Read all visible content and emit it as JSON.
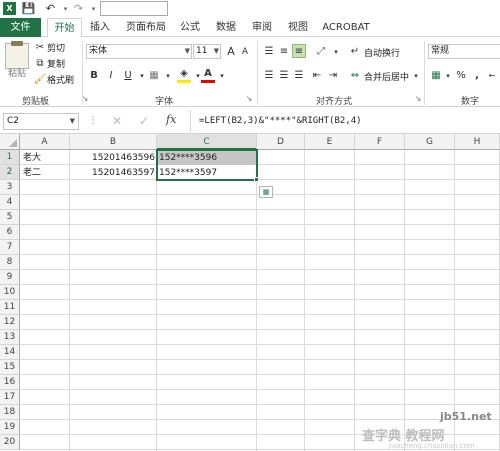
{
  "tabs": {
    "file": "文件",
    "home": "开始",
    "insert": "插入",
    "layout": "页面布局",
    "formulas": "公式",
    "data": "数据",
    "review": "审阅",
    "view": "视图",
    "acrobat": "ACROBAT"
  },
  "clipboard": {
    "paste": "粘贴",
    "cut": "剪切",
    "copy": "复制",
    "format_painter": "格式刷",
    "group": "剪贴板"
  },
  "font": {
    "name": "宋体",
    "size": "11",
    "group": "字体",
    "bold": "B",
    "italic": "I",
    "underline": "U",
    "grow": "A",
    "shrink": "A"
  },
  "alignment": {
    "wrap": "自动换行",
    "merge": "合并后居中",
    "group": "对齐方式"
  },
  "number": {
    "format": "常规",
    "group": "数字",
    "percent": "%",
    "comma": ","
  },
  "formula_bar": {
    "name_box": "C2",
    "fx": "fx",
    "formula": "=LEFT(B2,3)&\"****\"&RIGHT(B2,4)"
  },
  "columns": [
    "A",
    "B",
    "C",
    "D",
    "E",
    "F",
    "G",
    "H"
  ],
  "rows": [
    "1",
    "2",
    "3",
    "4",
    "5",
    "6",
    "7",
    "8",
    "9",
    "10",
    "11",
    "12",
    "13",
    "14",
    "15",
    "16",
    "17",
    "18",
    "19",
    "20"
  ],
  "cells": {
    "A1": "老大",
    "B1": "15201463596",
    "C1": "152****3596",
    "A2": "老二",
    "B2": "15201463597",
    "C2": "152****3597"
  },
  "watermark": {
    "site": "jb51.net",
    "text1": "查字典 教程网",
    "text2": "jiaocheng.chazidian.com"
  },
  "colors": {
    "accent": "#217346",
    "selection": "#c6c6c6"
  }
}
